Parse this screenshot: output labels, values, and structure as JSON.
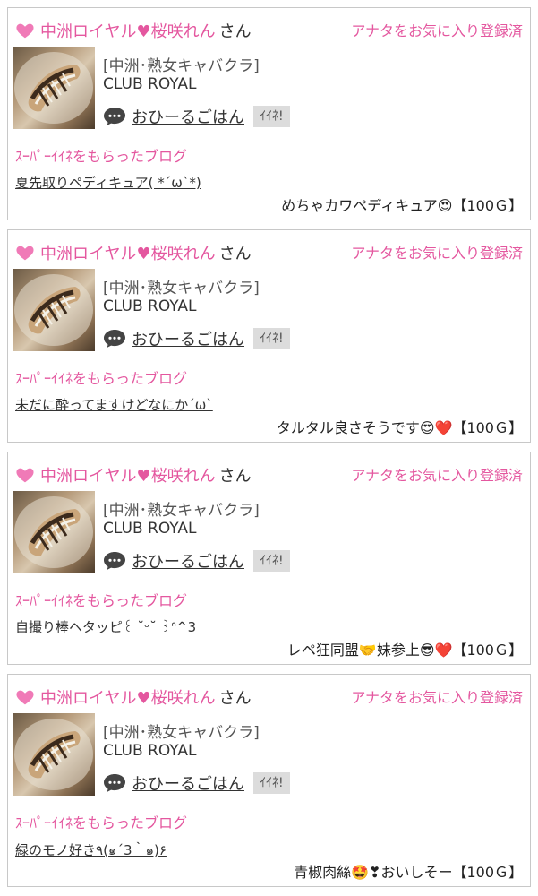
{
  "accent_color": "#e4579f",
  "cards": [
    {
      "shop_name": "中洲ロイヤル♥桜咲れん",
      "suffix": "さん",
      "favorite_label": "アナタをお気に入り登録済",
      "category": "[中洲･熟女キャバクラ]",
      "club": "CLUB ROYAL",
      "poster": "おひーるごはん",
      "iine": "ｲｲﾈ!",
      "super_iine_label": "ｽｰﾊﾟｰｲｲﾈをもらったブログ",
      "blog_title": "夏先取りペディキュア( *´ω`*)",
      "comment": "めちゃカワペディキュア😍【100Ｇ】"
    },
    {
      "shop_name": "中洲ロイヤル♥桜咲れん",
      "suffix": "さん",
      "favorite_label": "アナタをお気に入り登録済",
      "category": "[中洲･熟女キャバクラ]",
      "club": "CLUB ROYAL",
      "poster": "おひーるごはん",
      "iine": "ｲｲﾈ!",
      "super_iine_label": "ｽｰﾊﾟｰｲｲﾈをもらったブログ",
      "blog_title": "未だに酔ってますけどなにか´ω`",
      "comment": "タルタル良さそうです😍❤️【100Ｇ】"
    },
    {
      "shop_name": "中洲ロイヤル♥桜咲れん",
      "suffix": "さん",
      "favorite_label": "アナタをお気に入り登録済",
      "category": "[中洲･熟女キャバクラ]",
      "club": "CLUB ROYAL",
      "poster": "おひーるごはん",
      "iine": "ｲｲﾈ!",
      "super_iine_label": "ｽｰﾊﾟｰｲｲﾈをもらったブログ",
      "blog_title": "自撮り棒ヘタッピ꒰ ˘ᵕ˘ ꒱ᐢ^3",
      "comment": "レペ狂同盟🤝妹参上😎❤️【100Ｇ】"
    },
    {
      "shop_name": "中洲ロイヤル♥桜咲れん",
      "suffix": "さん",
      "favorite_label": "アナタをお気に入り登録済",
      "category": "[中洲･熟女キャバクラ]",
      "club": "CLUB ROYAL",
      "poster": "おひーるごはん",
      "iine": "ｲｲﾈ!",
      "super_iine_label": "ｽｰﾊﾟｰｲｲﾈをもらったブログ",
      "blog_title": "緑のモノ好き٩(๑´3｀๑)۶",
      "comment": "青椒肉絲🤩❣おいしそー【100Ｇ】"
    }
  ]
}
